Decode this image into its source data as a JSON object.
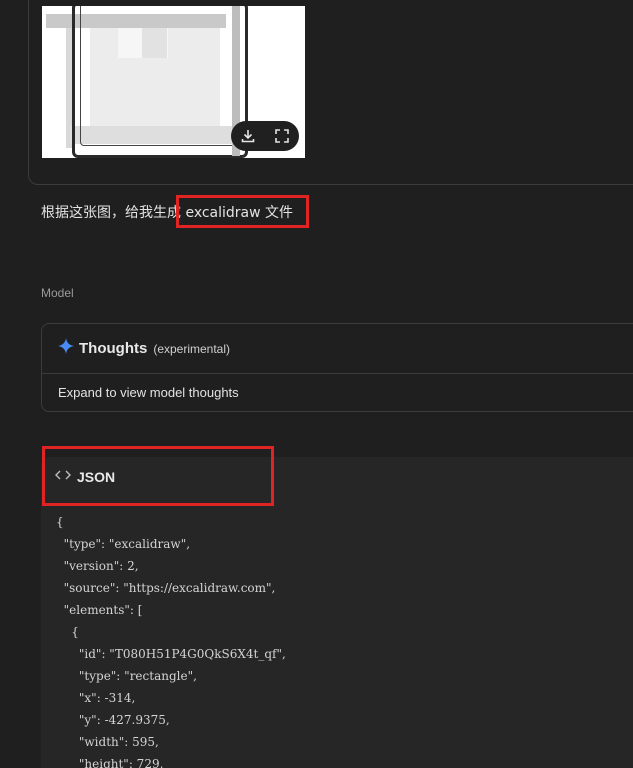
{
  "image_card": {
    "thumbnail_alt": "uploaded-image-thumbnail",
    "actions": [
      {
        "name": "download-icon"
      },
      {
        "name": "fullscreen-icon"
      }
    ]
  },
  "prompt": {
    "text": "根据这张图，给我生成 excalidraw 文件"
  },
  "model_label": "Model",
  "thoughts": {
    "title": "Thoughts",
    "subtitle": "(experimental)",
    "expand_text": "Expand to view model thoughts"
  },
  "code_block": {
    "language": "JSON",
    "lines": [
      "{",
      "  \"type\": \"excalidraw\",",
      "  \"version\": 2,",
      "  \"source\": \"https://excalidraw.com\",",
      "  \"elements\": [",
      "    {",
      "      \"id\": \"T080H51P4G0QkS6X4t_qf\",",
      "      \"type\": \"rectangle\",",
      "      \"x\": -314,",
      "      \"y\": -427.9375,",
      "      \"width\": 595,",
      "      \"height\": 729,"
    ]
  },
  "colors": {
    "background": "#1f1f1f",
    "highlight_box": "#e02424",
    "sparkle": "#4a8cf7"
  }
}
